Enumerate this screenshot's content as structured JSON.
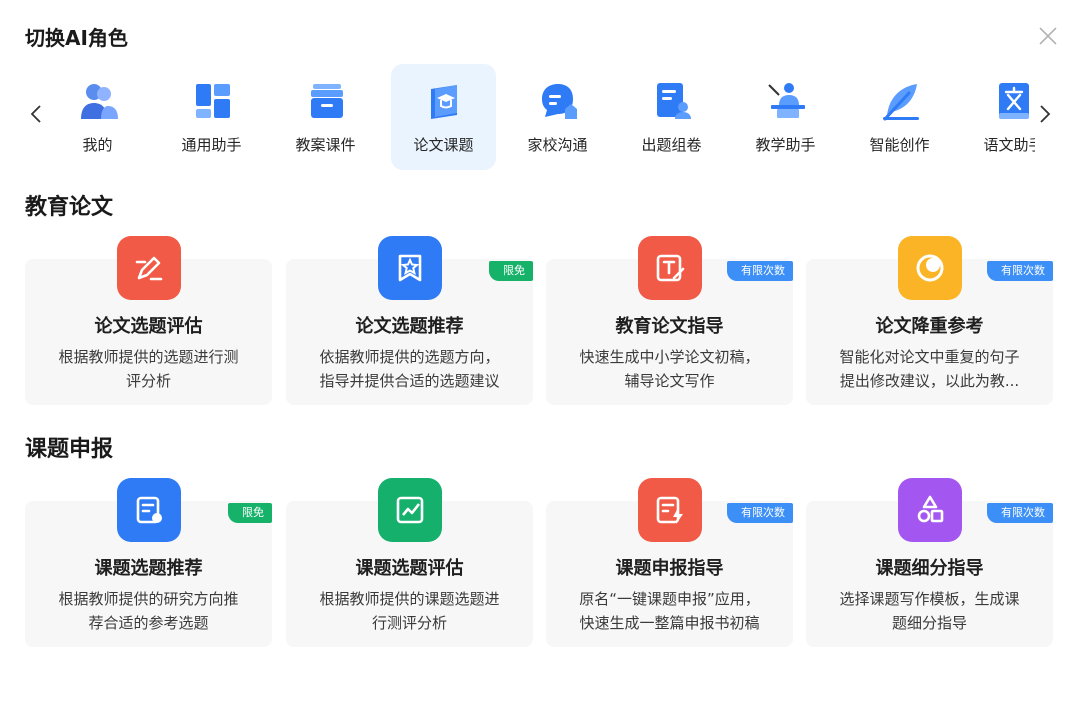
{
  "dialog": {
    "title": "切换AI角色"
  },
  "roles": [
    {
      "label": "我的",
      "icon": "users-icon",
      "active": false
    },
    {
      "label": "通用助手",
      "icon": "grid-icon",
      "active": false
    },
    {
      "label": "教案课件",
      "icon": "archive-box-icon",
      "active": false
    },
    {
      "label": "论文课题",
      "icon": "graduation-book-icon",
      "active": true
    },
    {
      "label": "家校沟通",
      "icon": "school-chat-icon",
      "active": false
    },
    {
      "label": "出题组卷",
      "icon": "exam-paper-icon",
      "active": false
    },
    {
      "label": "教学助手",
      "icon": "teacher-board-icon",
      "active": false
    },
    {
      "label": "智能创作",
      "icon": "feather-pen-icon",
      "active": false
    },
    {
      "label": "语文助手",
      "icon": "chinese-book-icon",
      "active": false
    }
  ],
  "sections": [
    {
      "title": "教育论文",
      "cards": [
        {
          "title": "论文选题评估",
          "desc": [
            "根据教师提供的选题进行测",
            "评分析"
          ],
          "badge": "",
          "icon": "pen-edit-icon",
          "color": "#f05a46"
        },
        {
          "title": "论文选题推荐",
          "desc": [
            "依据教师提供的选题方向，",
            "指导并提供合适的选题建议"
          ],
          "badge": "限免",
          "icon": "star-bookmark-icon",
          "color": "#2f7bf5"
        },
        {
          "title": "教育论文指导",
          "desc": [
            "快速生成中小学论文初稿，",
            "辅导论文写作"
          ],
          "badge": "有限次数",
          "icon": "text-edit-icon",
          "color": "#f05a46"
        },
        {
          "title": "论文降重参考",
          "desc": [
            "智能化对论文中重复的句子",
            "提出修改建议，以此为教..."
          ],
          "badge": "有限次数",
          "icon": "overlap-circles-icon",
          "color": "#fbb425"
        }
      ]
    },
    {
      "title": "课题申报",
      "cards": [
        {
          "title": "课题选题推荐",
          "desc": [
            "根据教师提供的研究方向推",
            "荐合适的参考选题"
          ],
          "badge": "限免",
          "icon": "document-badge-icon",
          "color": "#2f7bf5"
        },
        {
          "title": "课题选题评估",
          "desc": [
            "根据教师提供的课题选题进",
            "行测评分析"
          ],
          "badge": "",
          "icon": "chart-edit-icon",
          "color": "#14b06c"
        },
        {
          "title": "课题申报指导",
          "desc": [
            "原名“一键课题申报”应用，",
            "快速生成一整篇申报书初稿"
          ],
          "badge": "有限次数",
          "icon": "document-flash-icon",
          "color": "#f05a46"
        },
        {
          "title": "课题细分指导",
          "desc": [
            "选择课题写作模板，生成课",
            "题细分指导"
          ],
          "badge": "有限次数",
          "icon": "shapes-icon",
          "color": "#a457f0"
        }
      ]
    }
  ]
}
